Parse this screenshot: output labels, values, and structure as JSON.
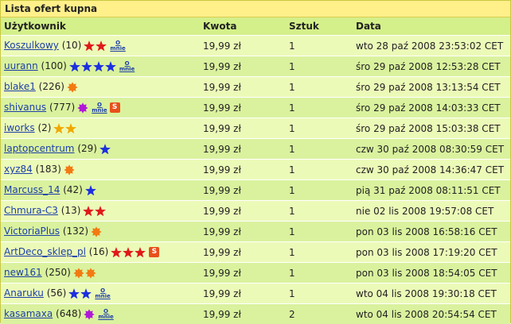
{
  "panel": {
    "title": "Lista ofert kupna"
  },
  "columns": {
    "user": "Użytkownik",
    "amount": "Kwota",
    "qty": "Sztuk",
    "date": "Data"
  },
  "badge_labels": {
    "about": "o mnie",
    "about_o": "O",
    "about_mnie": "mnie",
    "shop": "S"
  },
  "colors": {
    "red_star": "#e01818",
    "blue_star": "#1c2ee0",
    "gold_star": "#f0a800",
    "orange_gear": "#f27a12",
    "purple_gear": "#b018d8",
    "shop": "#e8501a",
    "link": "#1c3fa8"
  },
  "rows": [
    {
      "user": "Koszulkowy",
      "score": "(10)",
      "icon": "red-star",
      "icon_count": 2,
      "about": true,
      "shop": false,
      "amount": "19,99 zł",
      "qty": "1",
      "date": "wto 28 paź 2008 23:53:02 CET"
    },
    {
      "user": "uurann",
      "score": "(100)",
      "icon": "blue-star",
      "icon_count": 4,
      "about": true,
      "shop": false,
      "amount": "19,99 zł",
      "qty": "1",
      "date": "śro 29 paź 2008 12:53:28 CET"
    },
    {
      "user": "blake1",
      "score": "(226)",
      "icon": "orange-gear",
      "icon_count": 1,
      "about": false,
      "shop": false,
      "amount": "19,99 zł",
      "qty": "1",
      "date": "śro 29 paź 2008 13:13:54 CET"
    },
    {
      "user": "shivanus",
      "score": "(777)",
      "icon": "purple-gear",
      "icon_count": 1,
      "about": true,
      "shop": true,
      "amount": "19,99 zł",
      "qty": "1",
      "date": "śro 29 paź 2008 14:03:33 CET"
    },
    {
      "user": "iworks",
      "score": "(2)",
      "icon": "gold-star",
      "icon_count": 2,
      "about": false,
      "shop": false,
      "amount": "19,99 zł",
      "qty": "1",
      "date": "śro 29 paź 2008 15:03:38 CET"
    },
    {
      "user": "laptopcentrum",
      "score": "(29)",
      "icon": "blue-star",
      "icon_count": 1,
      "about": false,
      "shop": false,
      "amount": "19,99 zł",
      "qty": "1",
      "date": "czw 30 paź 2008 08:30:59 CET"
    },
    {
      "user": "xyz84",
      "score": "(183)",
      "icon": "orange-gear",
      "icon_count": 1,
      "about": false,
      "shop": false,
      "amount": "19,99 zł",
      "qty": "1",
      "date": "czw 30 paź 2008 14:36:47 CET"
    },
    {
      "user": "Marcuss_14",
      "score": "(42)",
      "icon": "blue-star",
      "icon_count": 1,
      "about": false,
      "shop": false,
      "amount": "19,99 zł",
      "qty": "1",
      "date": "pią 31 paź 2008 08:11:51 CET"
    },
    {
      "user": "Chmura-C3",
      "score": "(13)",
      "icon": "red-star",
      "icon_count": 2,
      "about": false,
      "shop": false,
      "amount": "19,99 zł",
      "qty": "1",
      "date": "nie 02 lis 2008 19:57:08 CET"
    },
    {
      "user": "VictoriaPlus",
      "score": "(132)",
      "icon": "orange-gear",
      "icon_count": 1,
      "about": false,
      "shop": false,
      "amount": "19,99 zł",
      "qty": "1",
      "date": "pon 03 lis 2008 16:58:16 CET"
    },
    {
      "user": "ArtDeco_sklep_pl",
      "score": "(16)",
      "icon": "red-star",
      "icon_count": 3,
      "about": false,
      "shop": true,
      "amount": "19,99 zł",
      "qty": "1",
      "date": "pon 03 lis 2008 17:19:20 CET"
    },
    {
      "user": "new161",
      "score": "(250)",
      "icon": "orange-gear",
      "icon_count": 2,
      "about": false,
      "shop": false,
      "amount": "19,99 zł",
      "qty": "1",
      "date": "pon 03 lis 2008 18:54:05 CET"
    },
    {
      "user": "Anaruku",
      "score": "(56)",
      "icon": "blue-star",
      "icon_count": 2,
      "about": true,
      "shop": false,
      "amount": "19,99 zł",
      "qty": "1",
      "date": "wto 04 lis 2008 19:30:18 CET"
    },
    {
      "user": "kasamaxa",
      "score": "(648)",
      "icon": "purple-gear",
      "icon_count": 1,
      "about": true,
      "shop": false,
      "amount": "19,99 zł",
      "qty": "2",
      "date": "wto 04 lis 2008 20:54:54 CET"
    }
  ]
}
